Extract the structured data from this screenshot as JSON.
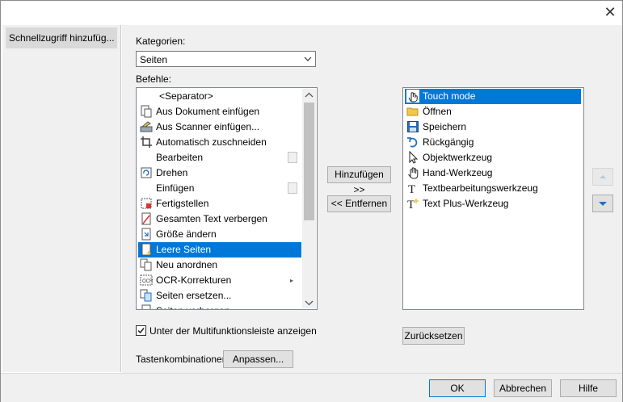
{
  "window": {
    "close_icon": "close-icon"
  },
  "left_pane": {
    "selected_item": "Schnellzugriff hinzufüg..."
  },
  "kategorien": {
    "label": "Kategorien:",
    "value": "Seiten"
  },
  "befehle": {
    "label": "Befehle:",
    "items": [
      {
        "label": "<Separator>",
        "icon": "none"
      },
      {
        "label": "Aus Dokument einfügen",
        "icon": "insert-document-icon"
      },
      {
        "label": "Aus Scanner einfügen...",
        "icon": "scanner-icon"
      },
      {
        "label": "Automatisch zuschneiden",
        "icon": "crop-icon"
      },
      {
        "label": "Bearbeiten",
        "icon": "none",
        "dropdown": true
      },
      {
        "label": "Drehen",
        "icon": "rotate-icon"
      },
      {
        "label": "Einfügen",
        "icon": "none",
        "dropdown": true
      },
      {
        "label": "Fertigstellen",
        "icon": "finalize-icon"
      },
      {
        "label": "Gesamten Text verbergen",
        "icon": "hide-text-icon"
      },
      {
        "label": "Größe ändern",
        "icon": "resize-icon"
      },
      {
        "label": "Leere Seiten",
        "icon": "blank-page-icon",
        "selected": true
      },
      {
        "label": "Neu anordnen",
        "icon": "reorder-icon"
      },
      {
        "label": "OCR-Korrekturen",
        "icon": "ocr-icon",
        "submenu": true
      },
      {
        "label": "Seiten ersetzen...",
        "icon": "replace-pages-icon"
      },
      {
        "label": "Seiten verbergen",
        "icon": "hide-pages-icon"
      }
    ]
  },
  "quick_access": {
    "items": [
      {
        "label": "Touch mode",
        "icon": "hand-touch-icon",
        "selected": true
      },
      {
        "label": "Öffnen",
        "icon": "folder-icon"
      },
      {
        "label": "Speichern",
        "icon": "save-icon"
      },
      {
        "label": "Rückgängig",
        "icon": "undo-icon"
      },
      {
        "label": "Objektwerkzeug",
        "icon": "pointer-icon"
      },
      {
        "label": "Hand-Werkzeug",
        "icon": "hand-icon"
      },
      {
        "label": "Textbearbeitungswerkzeug",
        "icon": "text-edit-icon"
      },
      {
        "label": "Text Plus-Werkzeug",
        "icon": "text-plus-icon"
      }
    ]
  },
  "buttons": {
    "hinzufuegen": "Hinzufügen >>",
    "entfernen": "<< Entfernen",
    "zuruecksetzen": "Zurücksetzen",
    "anpassen": "Anpassen...",
    "ok": "OK",
    "abbrechen": "Abbrechen",
    "hilfe": "Hilfe"
  },
  "checkbox": {
    "label": "Unter der Multifunktionsleiste anzeigen",
    "checked": true
  },
  "shortcuts": {
    "label": "Tastenkombinationen:"
  },
  "colors": {
    "selection": "#0078d7",
    "arrow_blue": "#1c73c5"
  }
}
